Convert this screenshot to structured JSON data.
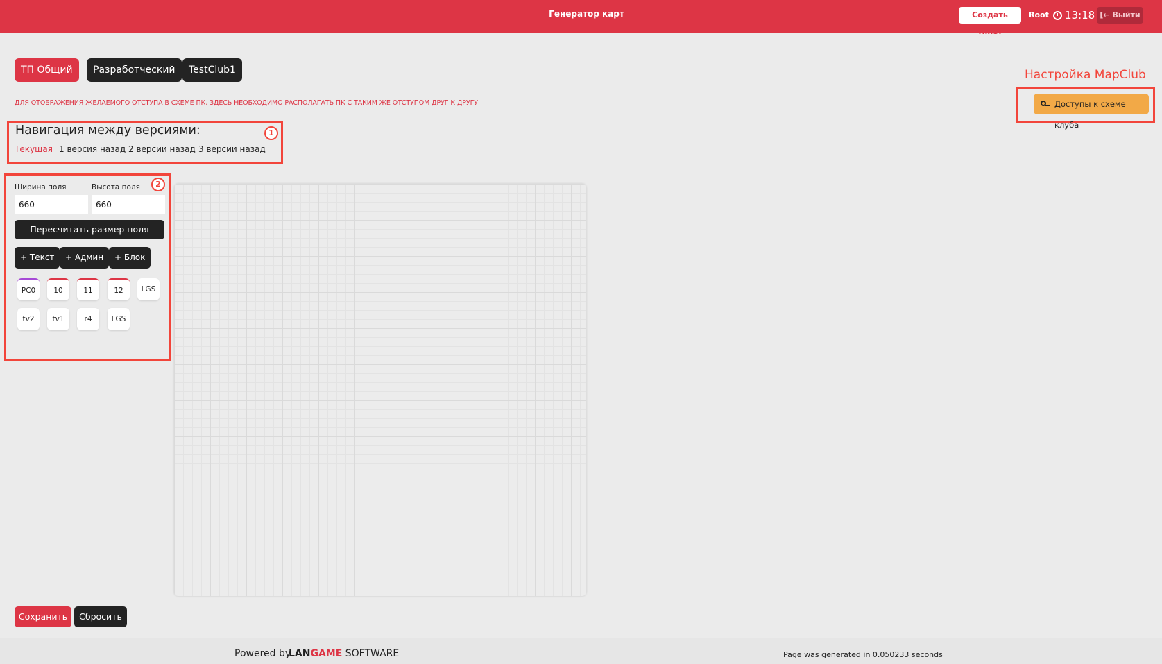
{
  "header": {
    "title": "Генератор карт",
    "create_ticket": "Создать тикет",
    "user": "Root",
    "time": "13:18",
    "logout": "Выйти"
  },
  "tabs": [
    {
      "label": "ТП Общий",
      "active": true
    },
    {
      "label": "Разработческий",
      "active": false
    },
    {
      "label": "TestClub1",
      "active": false
    }
  ],
  "notice": "ДЛЯ ОТОБРАЖЕНИЯ ЖЕЛАЕМОГО ОТСТУПА В СХЕМЕ ПК, ЗДЕСЬ НЕОБХОДИМО РАСПОЛАГАТЬ ПК С ТАКИМ ЖЕ ОТСТУПОМ ДРУГ К ДРУГУ",
  "mapclub": {
    "title": "Настройка MapClub",
    "access_button": "Доступы к схеме клуба"
  },
  "versions": {
    "title": "Навигация между версиями:",
    "links": [
      "Текущая",
      "1 версия назад",
      "2 версии назад",
      "3 версии назад"
    ],
    "badge": "1"
  },
  "editor": {
    "badge": "2",
    "width_label": "Ширина поля",
    "width_value": "660",
    "height_label": "Высота поля",
    "height_value": "660",
    "recalc": "Пересчитать размер поля",
    "add_buttons": [
      "+ Текст",
      "+ Админ",
      "+ Блок"
    ],
    "chips_row1": [
      "PC0",
      "10",
      "11",
      "12",
      "LGS"
    ],
    "chips_row2": [
      "tv2",
      "tv1",
      "r4",
      "LGS"
    ]
  },
  "actions": {
    "save": "Сохранить",
    "reset": "Сбросить"
  },
  "footer": {
    "powered": "Powered by",
    "brand_lan": "LAN",
    "brand_game": "GAME",
    "brand_software": "SOFTWARE",
    "generated": "Page was generated in 0.050233 seconds"
  },
  "colors": {
    "accent": "#dd3545",
    "annotation": "#f2453b",
    "warning": "#f2a947",
    "dark": "#232323"
  }
}
